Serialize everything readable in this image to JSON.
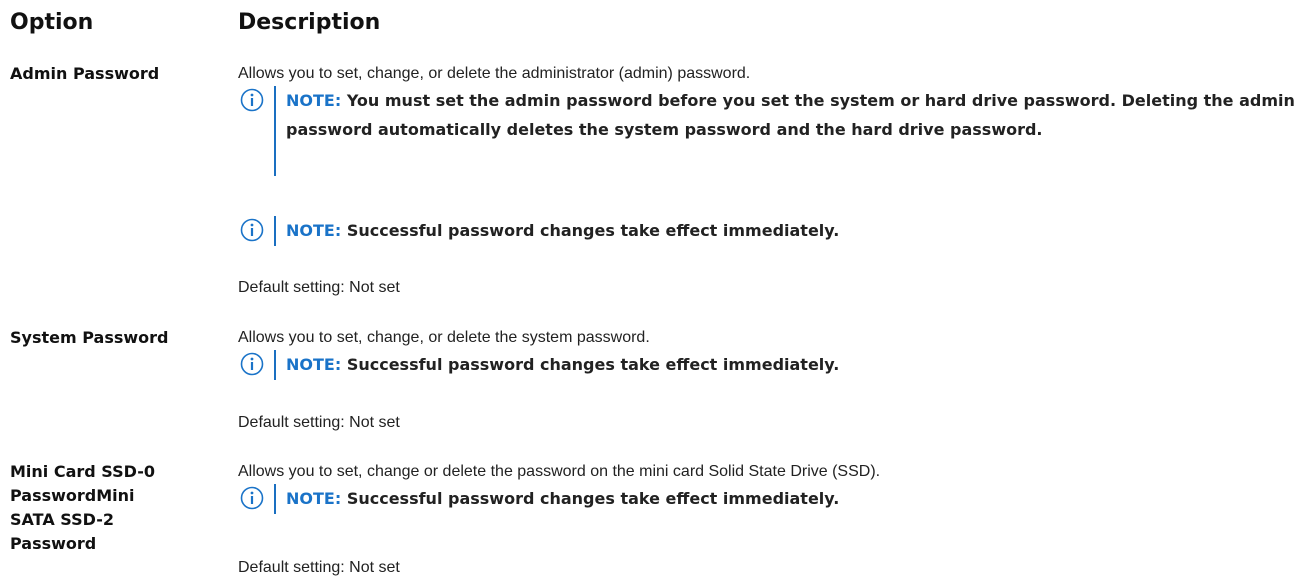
{
  "header": {
    "option": "Option",
    "description": "Description"
  },
  "rows": [
    {
      "option": "Admin Password",
      "description": "Allows you to set, change, or delete the administrator (admin) password.",
      "notes": [
        {
          "label": "NOTE:",
          "text": "You must set the admin password before you set the system or hard drive password. Deleting the admin password automatically deletes the system password and the hard drive password."
        },
        {
          "label": "NOTE:",
          "text": "Successful password changes take effect immediately."
        }
      ],
      "default": "Default setting: Not set"
    },
    {
      "option": "System Password",
      "description": "Allows you to set, change, or delete the system password.",
      "notes": [
        {
          "label": "NOTE:",
          "text": "Successful password changes take effect immediately."
        }
      ],
      "default": "Default setting: Not set"
    },
    {
      "option_lines": [
        "Mini Card SSD-0",
        "PasswordMini",
        "SATA SSD-2",
        "Password"
      ],
      "description": "Allows you to set, change or delete the password on the mini card Solid State Drive (SSD).",
      "notes": [
        {
          "label": "NOTE:",
          "text": "Successful password changes take effect immediately."
        }
      ],
      "default": "Default setting: Not set"
    }
  ],
  "colors": {
    "note_label": "#1a73c8",
    "note_bar": "#1a6fc1",
    "icon": "#1a73c8"
  },
  "icons": {
    "note": "info-icon"
  }
}
